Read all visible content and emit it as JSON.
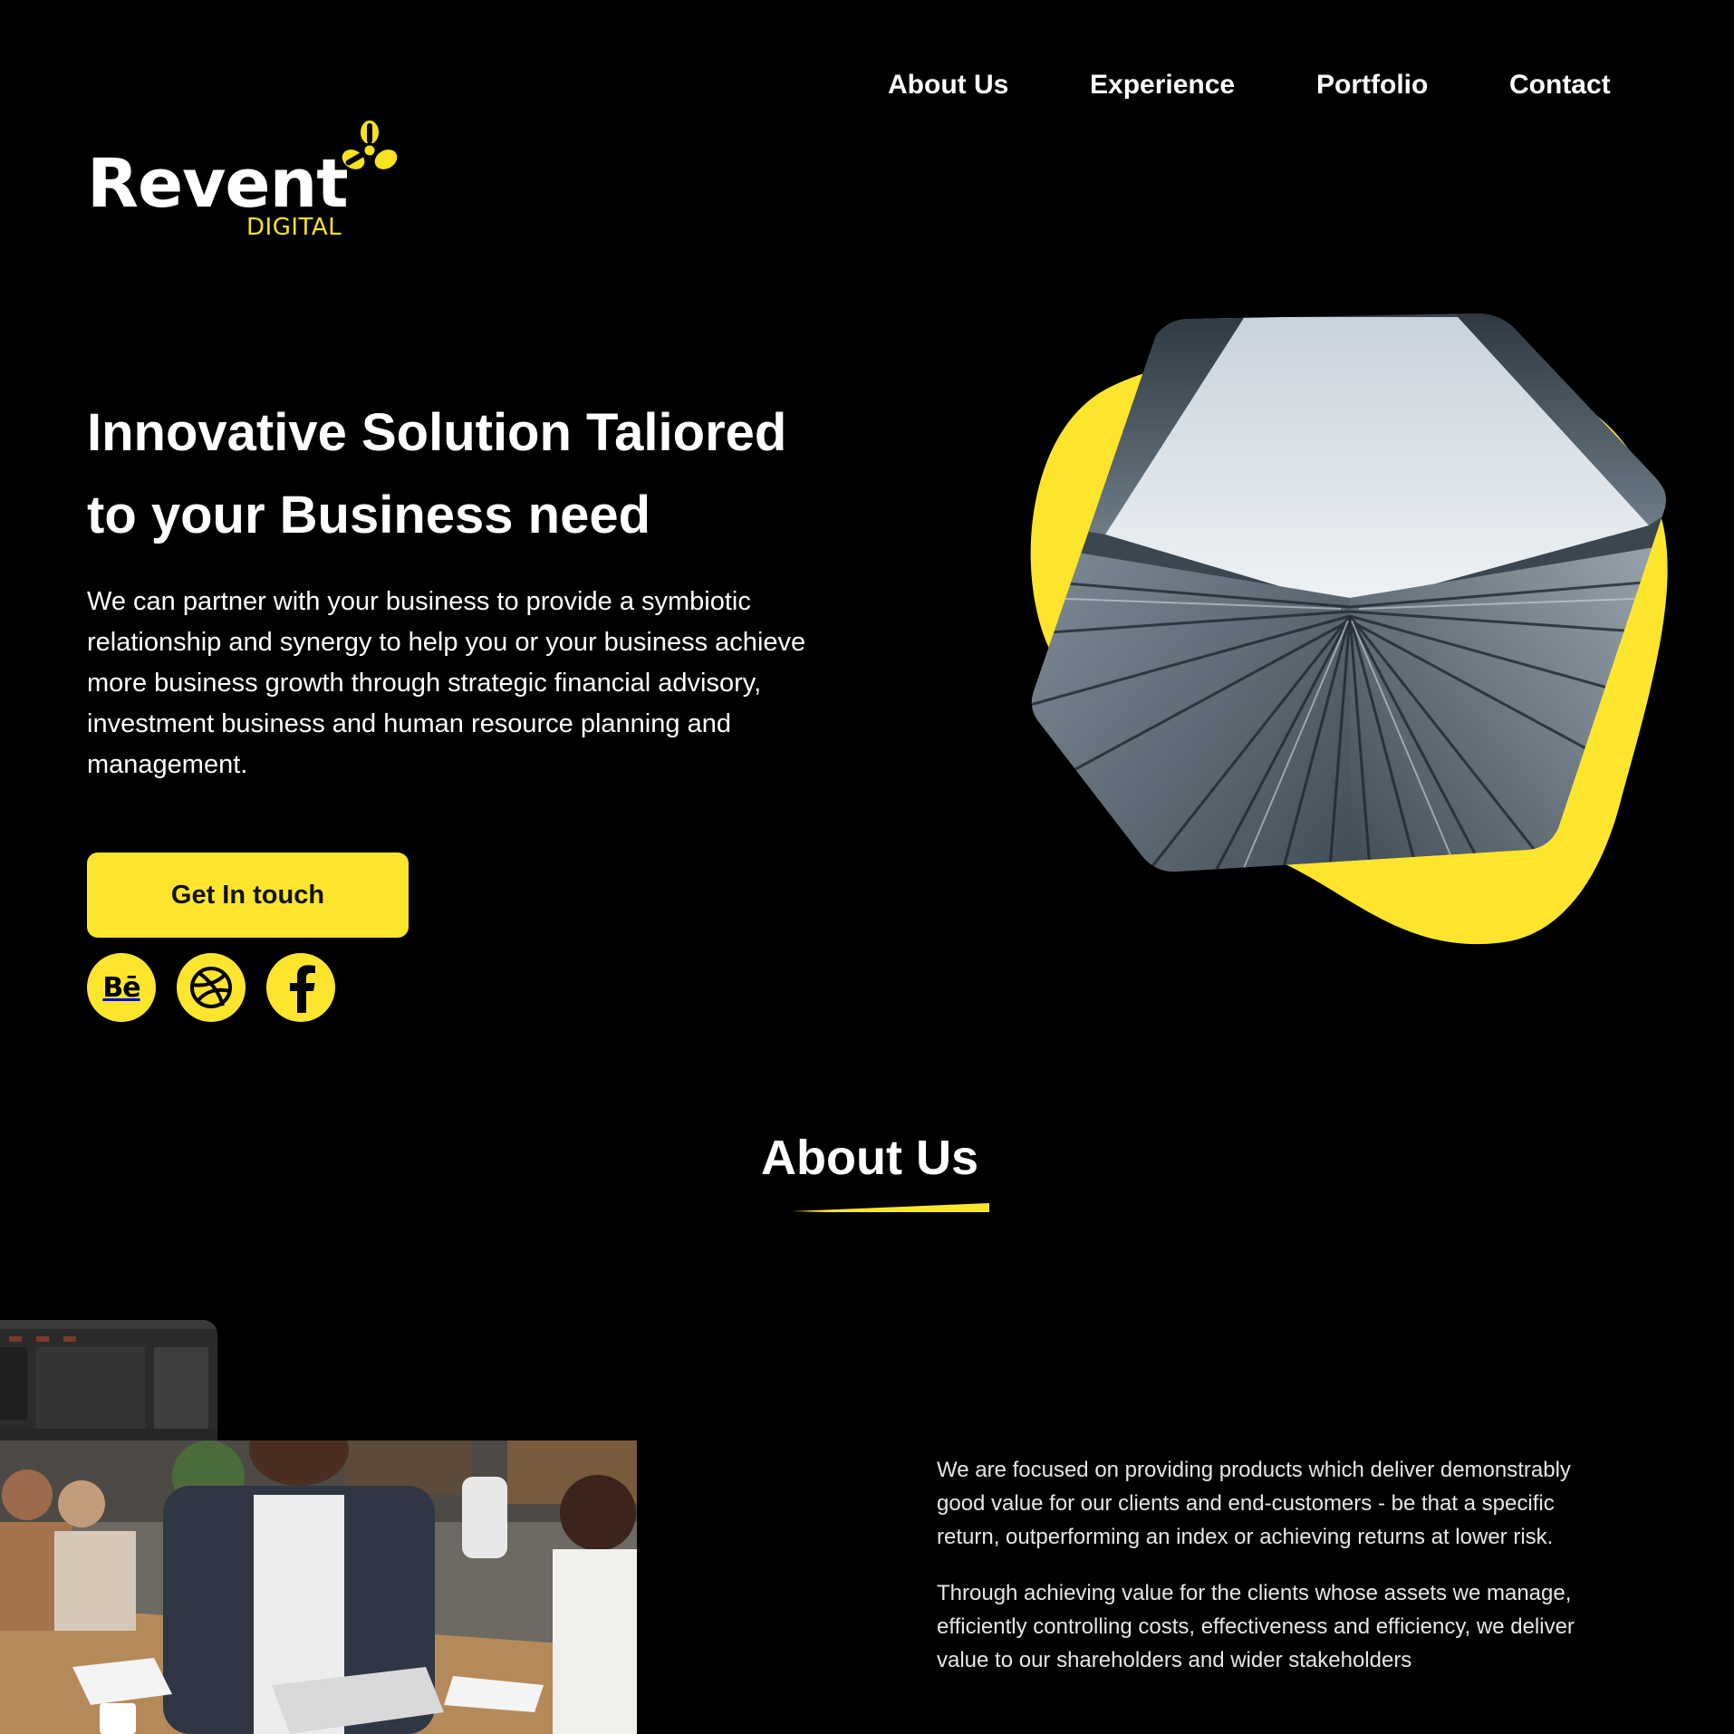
{
  "nav": {
    "items": [
      "About Us",
      "Experience",
      "Portfolio",
      "Contact"
    ]
  },
  "logo": {
    "wordmark": "Revent",
    "sub": "DIGITAL"
  },
  "hero": {
    "title_line1": "Innovative Solution Taliored",
    "title_line2": "to your Business need",
    "description": "We can partner with your business to provide a symbiotic relationship and synergy to help you or your business achieve more business growth through strategic financial advisory, investment business and human resource planning and management.",
    "cta_label": "Get In touch",
    "socials": [
      {
        "icon": "behance-icon",
        "glyph": "Bē"
      },
      {
        "icon": "dribbble-icon"
      },
      {
        "icon": "facebook-icon"
      }
    ]
  },
  "about": {
    "title": "About Us",
    "paragraphs": [
      "We are focused on providing products which deliver demonstrably good value for our clients and end-customers - be that a specific return, outperforming an index or achieving returns at lower risk.",
      "Through achieving value for the clients whose assets we manage, efficiently controlling costs, effectiveness and efficiency, we deliver value to our shareholders and wider stakeholders"
    ]
  },
  "colors": {
    "background": "#000000",
    "accent": "#fde52e",
    "text": "#ffffff"
  }
}
